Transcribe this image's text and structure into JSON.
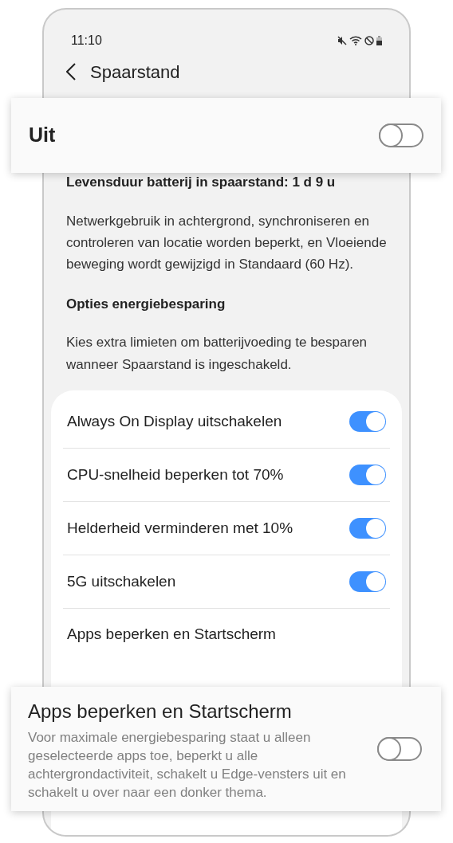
{
  "status_bar": {
    "time": "11:10"
  },
  "header": {
    "title": "Spaarstand"
  },
  "master": {
    "label": "Uit",
    "on": false
  },
  "battery_life": "Levensduur batterij in spaarstand: 1 d 9 u",
  "description": "Netwerkgebruik in achtergrond, synchroniseren en controleren van locatie worden beperkt, en Vloeiende beweging wordt gewijzigd in Standaard (60 Hz).",
  "options_heading": "Opties energiebesparing",
  "options_description": "Kies extra limieten om batterijvoeding te besparen wanneer Spaarstand is ingeschakeld.",
  "options": [
    {
      "label": "Always On Display uitschakelen",
      "on": true
    },
    {
      "label": "CPU-snelheid beperken tot 70%",
      "on": true
    },
    {
      "label": "Helderheid verminderen met 10%",
      "on": true
    },
    {
      "label": "5G uitschakelen",
      "on": true
    }
  ],
  "partial_option": {
    "label": "Apps beperken en Startscherm"
  },
  "callout": {
    "title": "Apps beperken en Startscherm",
    "description": "Voor maximale energiebesparing staat u alleen geselecteerde apps toe, beperkt u alle achtergrondactiviteit, schakelt u Edge-vensters uit en schakelt u over naar een donker thema.",
    "on": false
  }
}
